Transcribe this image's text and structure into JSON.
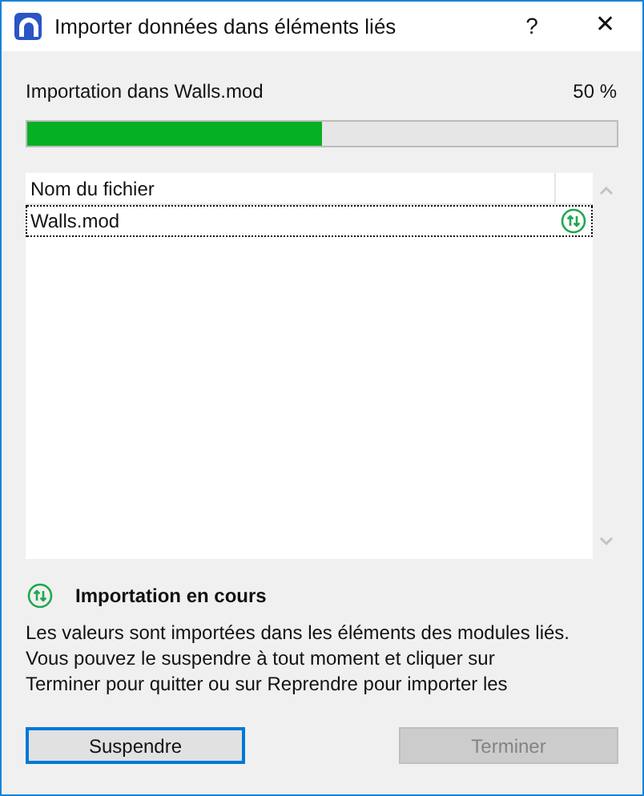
{
  "window": {
    "title": "Importer données dans éléments liés",
    "help": "?",
    "close": "✕"
  },
  "progress": {
    "label": "Importation dans Walls.mod",
    "percent": "50 %",
    "level": 0.5
  },
  "table": {
    "columns": [
      "Nom du fichier"
    ],
    "rows": [
      {
        "name": "Walls.mod",
        "selected": true,
        "kind": "importing"
      }
    ]
  },
  "status": {
    "kind": "importing",
    "title": "Importation en cours",
    "message": "Les valeurs sont importées dans les éléments des modules liés.\nVous pouvez le suspendre à tout moment et cliquer sur\nTerminer pour quitter ou sur Reprendre pour importer les"
  },
  "buttons": [
    {
      "label": "Suspendre",
      "disabled": false,
      "focused": true
    },
    {
      "label": "Terminer",
      "disabled": true,
      "focused": false
    }
  ]
}
